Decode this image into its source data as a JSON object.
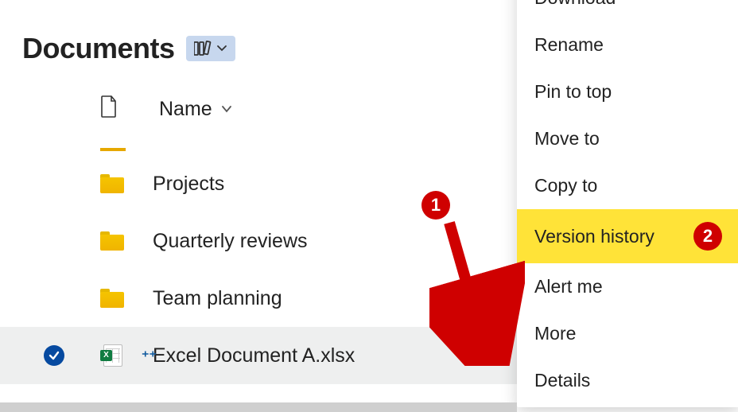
{
  "header": {
    "title": "Documents"
  },
  "columns": {
    "name": "Name"
  },
  "rows": [
    {
      "type": "folder",
      "name": "Projects"
    },
    {
      "type": "folder",
      "name": "Quarterly reviews"
    },
    {
      "type": "folder",
      "name": "Team planning"
    },
    {
      "type": "file",
      "name": "Excel Document A.xlsx",
      "selected": true
    }
  ],
  "menu": {
    "items": [
      "Download",
      "Rename",
      "Pin to top",
      "Move to",
      "Copy to",
      "Version history",
      "Alert me",
      "More",
      "Details"
    ],
    "highlighted": "Version history"
  },
  "annotations": {
    "step1": "1",
    "step2": "2"
  }
}
